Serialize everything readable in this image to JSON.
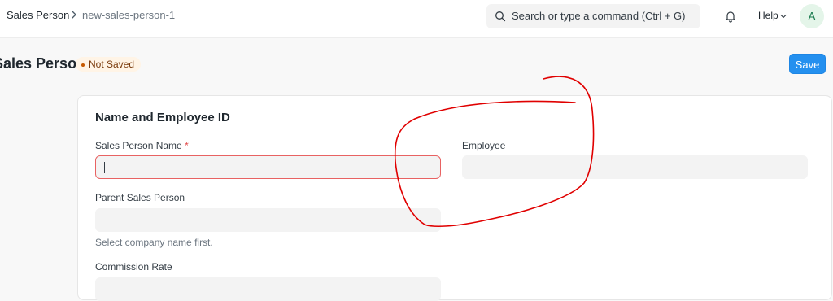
{
  "navbar": {
    "breadcrumbs": [
      "Sales Person",
      "new-sales-person-1"
    ],
    "search_placeholder": "Search or type a command (Ctrl + G)",
    "help_label": "Help",
    "avatar_initial": "A"
  },
  "page": {
    "title": "Sales Person",
    "status": "Not Saved",
    "save_label": "Save"
  },
  "form": {
    "section_title": "Name and Employee ID",
    "fields": {
      "sales_person_name": {
        "label": "Sales Person Name",
        "required_mark": "*",
        "value": ""
      },
      "employee": {
        "label": "Employee",
        "value": ""
      },
      "parent_sales_person": {
        "label": "Parent Sales Person",
        "value": "",
        "help_text": "Select company name first."
      },
      "commission_rate": {
        "label": "Commission Rate",
        "value": ""
      }
    }
  },
  "colors": {
    "primary": "#2490ef",
    "status_orange": "#c65800",
    "required_red": "#e24c4c",
    "annotation_red": "#e00000"
  }
}
